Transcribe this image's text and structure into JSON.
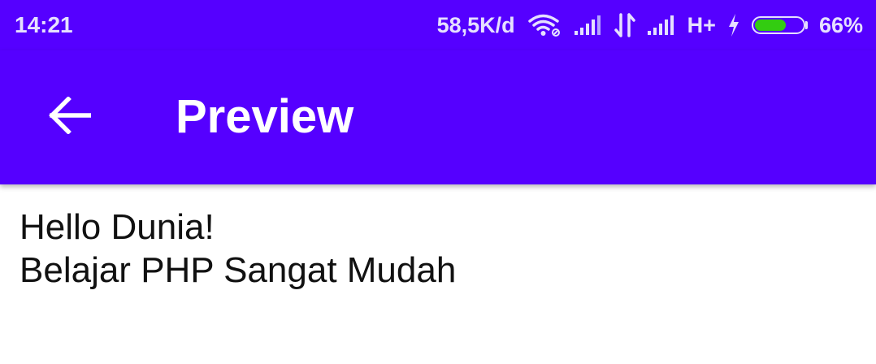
{
  "status_bar": {
    "time": "14:21",
    "network_speed": "58,5K/d",
    "network_type": "H+",
    "battery_percent": "66%",
    "battery_level": 0.66,
    "icons": [
      "wifi-icon",
      "signal-icon",
      "data-transfer-icon",
      "signal-icon",
      "charging-icon",
      "battery-icon"
    ]
  },
  "app_bar": {
    "title": "Preview",
    "back_icon": "arrow-left-icon",
    "color": "#5500ff"
  },
  "content": {
    "lines": [
      "Hello Dunia!",
      "Belajar PHP Sangat Mudah"
    ]
  }
}
